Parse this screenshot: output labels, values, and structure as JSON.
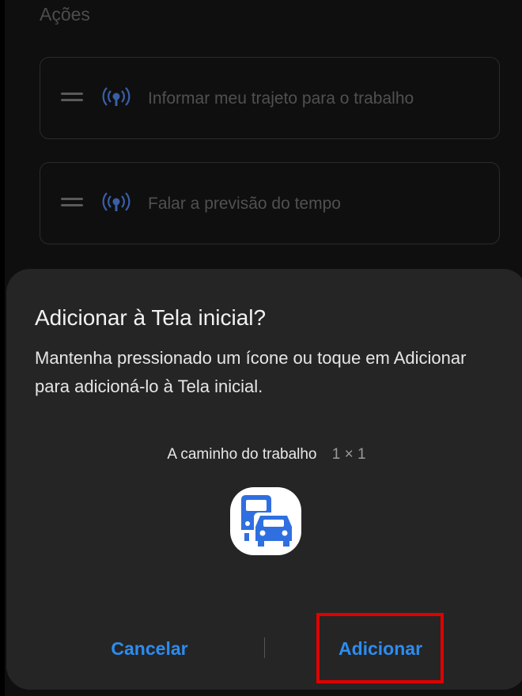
{
  "background": {
    "section_title": "Ações",
    "actions": [
      {
        "label": "Informar meu trajeto para o trabalho",
        "icon": "broadcast-icon"
      },
      {
        "label": "Falar a previsão do tempo",
        "icon": "broadcast-icon"
      }
    ]
  },
  "dialog": {
    "title": "Adicionar à Tela inicial?",
    "body": "Mantenha pressionado um ícone ou toque em Adicionar para adicioná-lo à Tela inicial.",
    "widget_name": "A caminho do trabalho",
    "widget_size": "1 × 1",
    "widget_icon": "commute-icon",
    "cancel_label": "Cancelar",
    "add_label": "Adicionar"
  },
  "colors": {
    "accent": "#2d8cf0",
    "dialog_bg": "#252525",
    "highlight": "#e00000",
    "icon_blue": "#2f6fe0"
  }
}
